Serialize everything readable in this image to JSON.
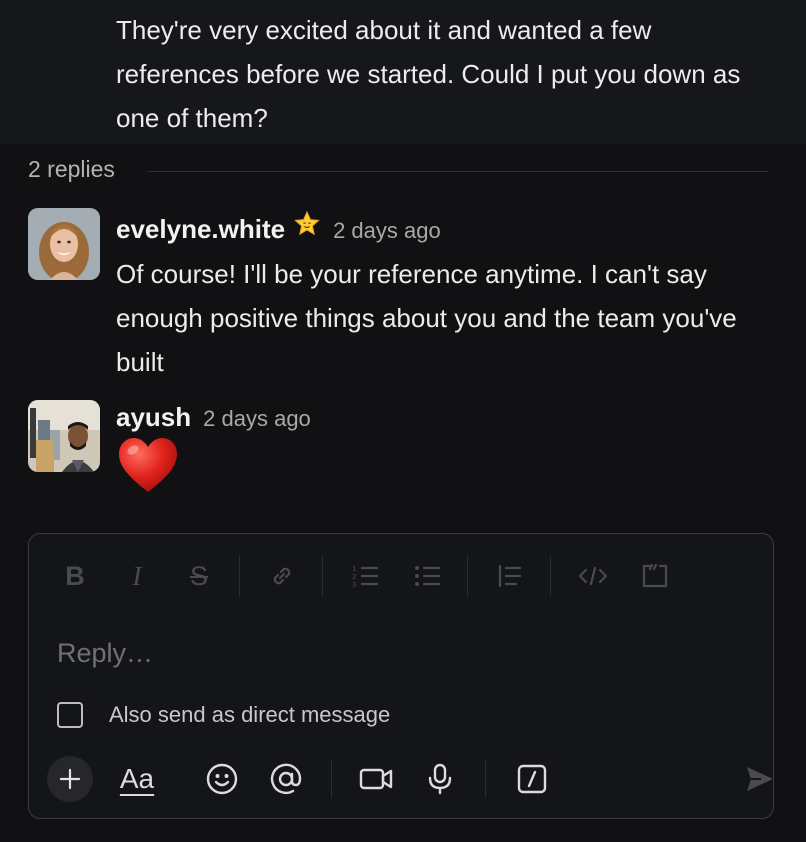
{
  "parent_message": {
    "text": "They're very excited about it and wanted a few references before we started. Could I put you down as one of them?"
  },
  "thread": {
    "reply_count_label": "2 replies"
  },
  "replies": [
    {
      "author": "evelyne.white",
      "status_icon": "star-emoji",
      "time": "2 days ago",
      "text": "Of course! I'll be your reference anytime. I can't say enough positive things about you and the team you've built"
    },
    {
      "author": "ayush",
      "time": "2 days ago",
      "text": "❤️"
    }
  ],
  "composer": {
    "placeholder": "Reply…",
    "also_send_dm_label": "Also send as direct message",
    "format_toolbar": [
      "bold",
      "italic",
      "strikethrough",
      "link",
      "ordered-list",
      "bulleted-list",
      "blockquote",
      "code",
      "code-block"
    ],
    "actions": [
      "plus",
      "formatting",
      "emoji",
      "mention",
      "video",
      "audio",
      "shortcuts",
      "send"
    ],
    "formatting_label": "Aa"
  },
  "colors": {
    "background": "#111113",
    "heart": "#e0241c",
    "muted": "#4a4b50"
  }
}
